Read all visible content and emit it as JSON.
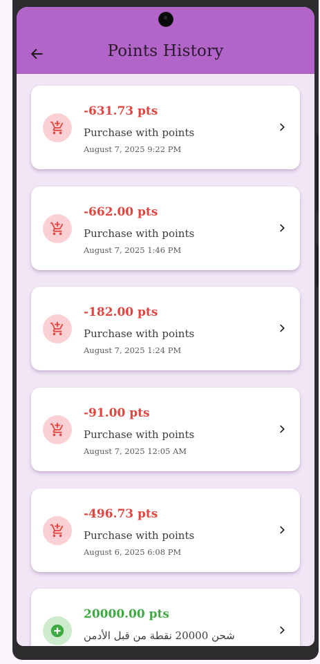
{
  "app_bar": {
    "title": "Points History",
    "back_icon": "arrow-left-icon",
    "background": "#b364c8"
  },
  "colors": {
    "negative_amount": "#e2453f",
    "negative_icon_bg": "#fbd0d4",
    "positive_amount": "#3faa44",
    "positive_icon_bg": "#cdebcd",
    "screen_bg": "#f1e6f6"
  },
  "transactions": [
    {
      "amount": "-631.73 pts",
      "description": "Purchase with points",
      "date": "August 7, 2025 9:22 PM",
      "type": "debit",
      "icon": "cart-icon"
    },
    {
      "amount": "-662.00 pts",
      "description": "Purchase with points",
      "date": "August 7, 2025 1:46 PM",
      "type": "debit",
      "icon": "cart-icon"
    },
    {
      "amount": "-182.00 pts",
      "description": "Purchase with points",
      "date": "August 7, 2025 1:24 PM",
      "type": "debit",
      "icon": "cart-icon"
    },
    {
      "amount": "-91.00 pts",
      "description": "Purchase with points",
      "date": "August 7, 2025 12:05 AM",
      "type": "debit",
      "icon": "cart-icon"
    },
    {
      "amount": "-496.73 pts",
      "description": "Purchase with points",
      "date": "August 6, 2025 6:08 PM",
      "type": "debit",
      "icon": "cart-icon"
    },
    {
      "amount": "20000.00 pts",
      "description": "شحن 20000 نقطة من قبل الأدمن",
      "date": "",
      "type": "credit",
      "icon": "add-circle-icon"
    }
  ]
}
